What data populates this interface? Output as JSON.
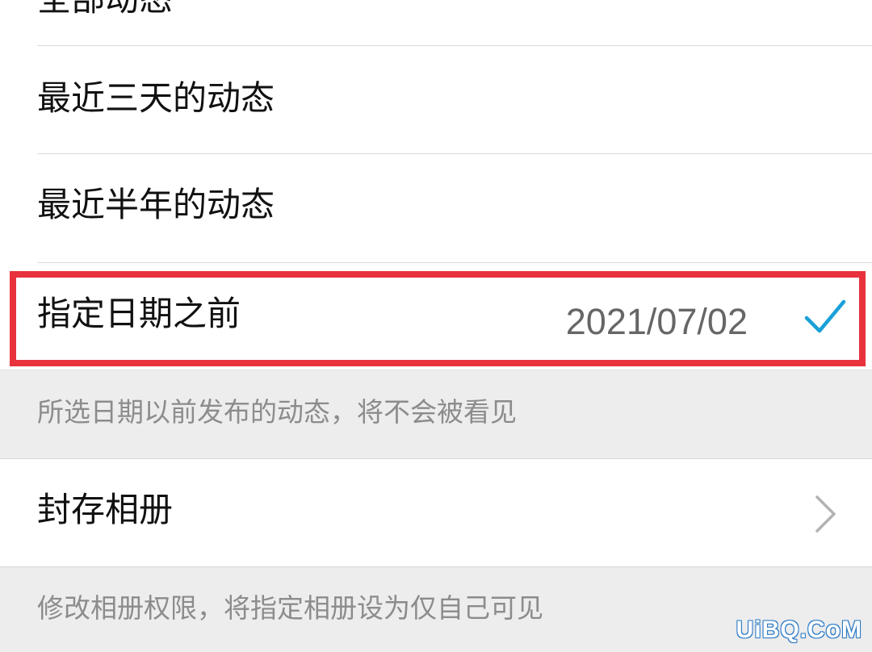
{
  "options": {
    "partial_top_label": "全部动态",
    "items": [
      {
        "label": "最近三天的动态"
      },
      {
        "label": "最近半年的动态"
      },
      {
        "label": "指定日期之前",
        "value": "2021/07/02",
        "selected": true
      }
    ]
  },
  "hints": {
    "date_hint": "所选日期以前发布的动态，将不会被看见",
    "album_hint": "修改相册权限，将指定相册设为仅自己可见"
  },
  "album": {
    "label": "封存相册"
  },
  "icons": {
    "selected": "checkmark-icon",
    "navigate": "chevron-right-icon"
  },
  "colors": {
    "accent": "#1aa0d8",
    "highlight": "#e8323c"
  },
  "watermark": "UiBQ.CoM"
}
